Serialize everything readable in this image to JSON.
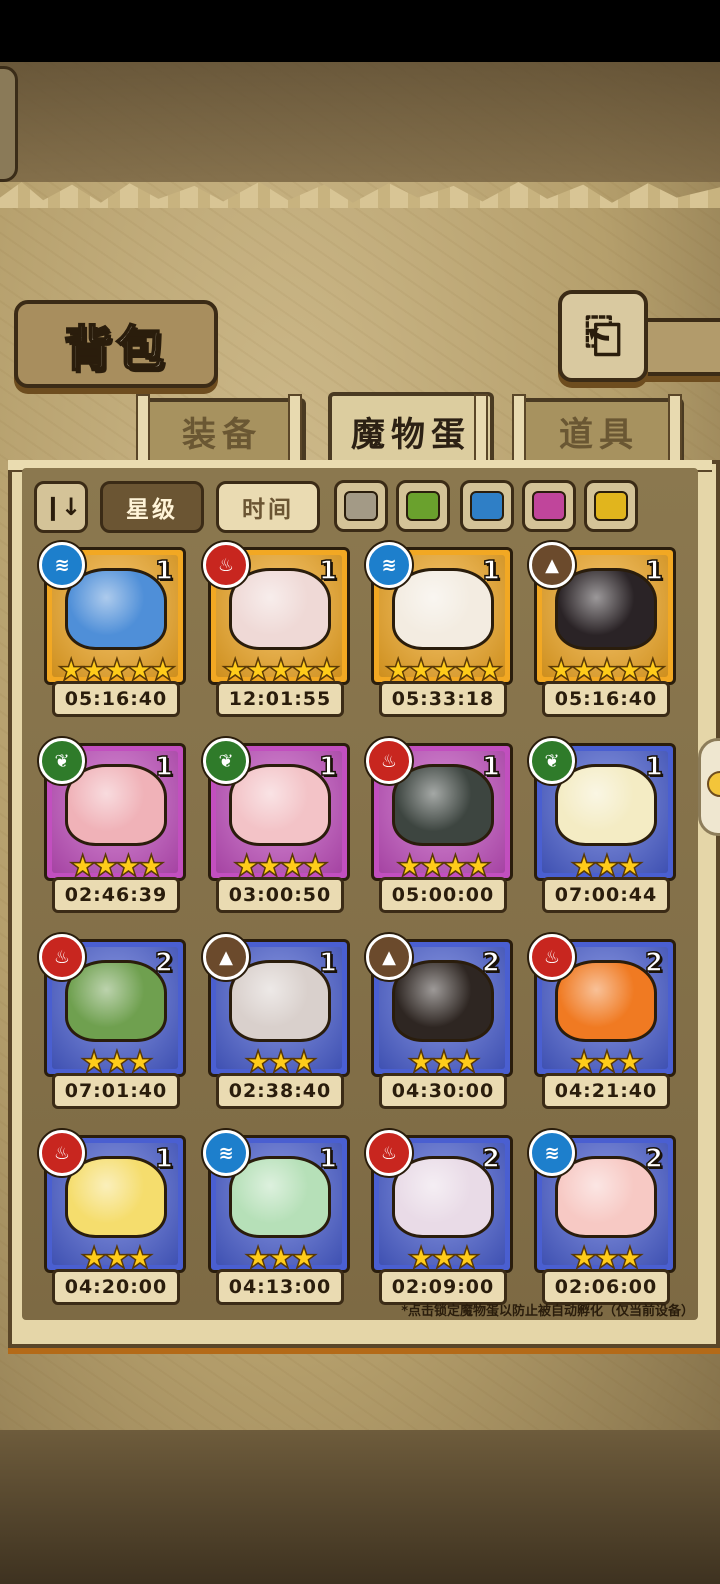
{
  "title": "背包",
  "back_icon": "⎗",
  "tabs": [
    {
      "label": "装备",
      "active": false
    },
    {
      "label": "魔物蛋",
      "active": true
    },
    {
      "label": "道具",
      "active": false
    }
  ],
  "filters": {
    "sort_toggle_icon": "pause-sort-icon",
    "star_label": "星级",
    "time_label": "时间",
    "color_chips": [
      "#a39a86",
      "#6aa12d",
      "#2f7fc6",
      "#c0459b",
      "#e1b51d"
    ]
  },
  "element_colors": {
    "water": "#1d7fcc",
    "fire": "#c8261f",
    "earth": "#6b4a2c",
    "plant": "#2f7b2a"
  },
  "rarity_colors": {
    "gold": "#f2a823",
    "purple": "#c24fbf",
    "blue": "#4a5fd1"
  },
  "eggs": [
    {
      "element": "water",
      "glyph": "≋",
      "count": "1",
      "stars": "★★★★★",
      "rarity": "gold",
      "timer": "05:16:40",
      "art": "#4f8fd8"
    },
    {
      "element": "fire",
      "glyph": "♨",
      "count": "1",
      "stars": "★★★★★",
      "rarity": "gold",
      "timer": "12:01:55",
      "art": "#efd9d6"
    },
    {
      "element": "water",
      "glyph": "≋",
      "count": "1",
      "stars": "★★★★★",
      "rarity": "gold",
      "timer": "05:33:18",
      "art": "#f3ece1"
    },
    {
      "element": "earth",
      "glyph": "▲",
      "count": "1",
      "stars": "★★★★★",
      "rarity": "gold",
      "timer": "05:16:40",
      "art": "#2a2326"
    },
    {
      "element": "plant",
      "glyph": "❦",
      "count": "1",
      "stars": "★★★★",
      "rarity": "purple",
      "timer": "02:46:39",
      "art": "#f0b2b8"
    },
    {
      "element": "plant",
      "glyph": "❦",
      "count": "1",
      "stars": "★★★★",
      "rarity": "purple",
      "timer": "03:00:50",
      "art": "#f3c3c7"
    },
    {
      "element": "fire",
      "glyph": "♨",
      "count": "1",
      "stars": "★★★★",
      "rarity": "purple",
      "timer": "05:00:00",
      "art": "#3d4540"
    },
    {
      "element": "plant",
      "glyph": "❦",
      "count": "1",
      "stars": "★★★",
      "rarity": "blue",
      "timer": "07:00:44",
      "art": "#f4ecc4"
    },
    {
      "element": "fire",
      "glyph": "♨",
      "count": "2",
      "stars": "★★★",
      "rarity": "blue",
      "timer": "07:01:40",
      "art": "#6fa04f"
    },
    {
      "element": "earth",
      "glyph": "▲",
      "count": "1",
      "stars": "★★★",
      "rarity": "blue",
      "timer": "02:38:40",
      "art": "#d9d0cc"
    },
    {
      "element": "earth",
      "glyph": "▲",
      "count": "2",
      "stars": "★★★",
      "rarity": "blue",
      "timer": "04:30:00",
      "art": "#2e2622"
    },
    {
      "element": "fire",
      "glyph": "♨",
      "count": "2",
      "stars": "★★★",
      "rarity": "blue",
      "timer": "04:21:40",
      "art": "#f07a22"
    },
    {
      "element": "fire",
      "glyph": "♨",
      "count": "1",
      "stars": "★★★",
      "rarity": "blue",
      "timer": "04:20:00",
      "art": "#f5dd6d"
    },
    {
      "element": "water",
      "glyph": "≋",
      "count": "1",
      "stars": "★★★",
      "rarity": "blue",
      "timer": "04:13:00",
      "art": "#b6e0b8"
    },
    {
      "element": "fire",
      "glyph": "♨",
      "count": "2",
      "stars": "★★★",
      "rarity": "blue",
      "timer": "02:09:00",
      "art": "#e9dbe7"
    },
    {
      "element": "water",
      "glyph": "≋",
      "count": "2",
      "stars": "★★★",
      "rarity": "blue",
      "timer": "02:06:00",
      "art": "#f7c9c4"
    }
  ],
  "footer_note": "*点击锁定魔物蛋以防止被自动孵化（仅当前设备）"
}
